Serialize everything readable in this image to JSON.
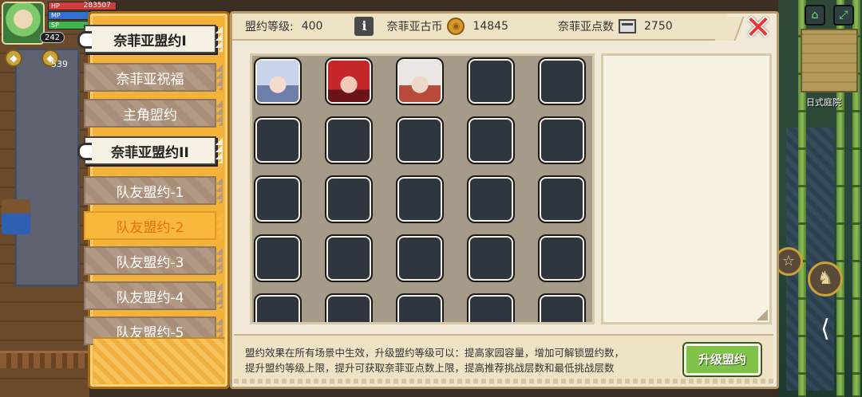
{
  "hud": {
    "hp": "283507",
    "hp_label": "HP",
    "mp_label": "MP",
    "sp_label": "SP",
    "level": "242",
    "badge_count": "539",
    "minimap_label": "日式庭院"
  },
  "header": {
    "level_label": "盟约等级:",
    "level_value": "400",
    "coin_label": "奈菲亚古币",
    "coin_value": "14845",
    "points_label": "奈菲亚点数",
    "points_value": "2750"
  },
  "nav": {
    "items": [
      {
        "label": "奈菲亚盟约I"
      },
      {
        "label": "奈菲亚祝福"
      },
      {
        "label": "主角盟约"
      },
      {
        "label": "奈菲亚盟约II"
      },
      {
        "label": "队友盟约-1"
      },
      {
        "label": "队友盟约-2"
      },
      {
        "label": "队友盟约-3"
      },
      {
        "label": "队友盟约-4"
      },
      {
        "label": "队友盟约-5"
      }
    ]
  },
  "description": {
    "line1": "盟约效果在所有场景中生效，升级盟约等级可以：提高家园容量，增加可解锁盟约数，",
    "line2": "提升盟约等级上限，提升可获取奈菲亚点数上限，提高推荐挑战层数和最低挑战层数"
  },
  "buttons": {
    "upgrade": "升级盟约",
    "close": "✕",
    "info": "i"
  },
  "colors": {
    "rail": "#f3b23a",
    "active_text": "#e86f10",
    "upgrade": "#7fc24a",
    "close": "#e33333"
  }
}
